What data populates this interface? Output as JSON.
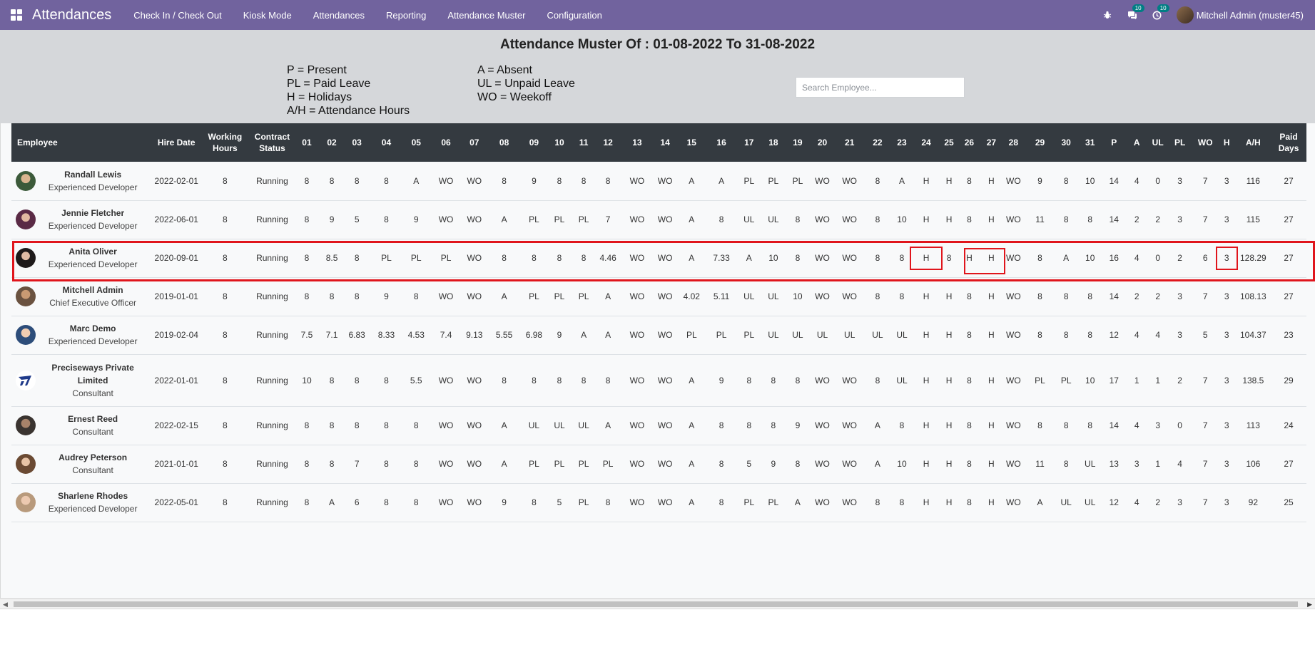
{
  "navbar": {
    "app_title": "Attendances",
    "menu": [
      "Check In / Check Out",
      "Kiosk Mode",
      "Attendances",
      "Reporting",
      "Attendance Muster",
      "Configuration"
    ],
    "messages_badge": "10",
    "activities_badge": "10",
    "user_name": "Mitchell Admin (muster45)",
    "accent_color": "#71639e"
  },
  "header": {
    "title": "Attendance Muster Of : 01-08-2022 To 31-08-2022",
    "legend_left": [
      "P = Present",
      "PL = Paid Leave",
      "H = Holidays",
      "A/H = Attendance Hours"
    ],
    "legend_right": [
      "A = Absent",
      "UL = Unpaid Leave",
      "WO = Weekoff"
    ],
    "search_placeholder": "Search Employee..."
  },
  "table": {
    "columns": [
      "Employee",
      "Hire Date",
      "Working Hours",
      "Contract Status",
      "01",
      "02",
      "03",
      "04",
      "05",
      "06",
      "07",
      "08",
      "09",
      "10",
      "11",
      "12",
      "13",
      "14",
      "15",
      "16",
      "17",
      "18",
      "19",
      "20",
      "21",
      "22",
      "23",
      "24",
      "25",
      "26",
      "27",
      "28",
      "29",
      "30",
      "31",
      "P",
      "A",
      "UL",
      "PL",
      "WO",
      "H",
      "A/H",
      "Paid Days"
    ],
    "rows": [
      {
        "name": "Randall Lewis",
        "job": "Experienced Developer",
        "cells": [
          "2022-02-01",
          "8",
          "Running",
          "8",
          "8",
          "8",
          "8",
          "A",
          "WO",
          "WO",
          "8",
          "9",
          "8",
          "8",
          "8",
          "WO",
          "WO",
          "A",
          "A",
          "PL",
          "PL",
          "PL",
          "WO",
          "WO",
          "8",
          "A",
          "H",
          "H",
          "8",
          "H",
          "WO",
          "9",
          "8",
          "10",
          "14",
          "4",
          "0",
          "3",
          "7",
          "3",
          "116",
          "27"
        ]
      },
      {
        "name": "Jennie Fletcher",
        "job": "Experienced Developer",
        "cells": [
          "2022-06-01",
          "8",
          "Running",
          "8",
          "9",
          "5",
          "8",
          "9",
          "WO",
          "WO",
          "A",
          "PL",
          "PL",
          "PL",
          "7",
          "WO",
          "WO",
          "A",
          "8",
          "UL",
          "UL",
          "8",
          "WO",
          "WO",
          "8",
          "10",
          "H",
          "H",
          "8",
          "H",
          "WO",
          "11",
          "8",
          "8",
          "14",
          "2",
          "2",
          "3",
          "7",
          "3",
          "115",
          "27"
        ]
      },
      {
        "name": "Anita Oliver",
        "job": "Experienced Developer",
        "cells": [
          "2020-09-01",
          "8",
          "Running",
          "8",
          "8.5",
          "8",
          "PL",
          "PL",
          "PL",
          "WO",
          "8",
          "8",
          "8",
          "8",
          "4.46",
          "WO",
          "WO",
          "A",
          "7.33",
          "A",
          "10",
          "8",
          "WO",
          "WO",
          "8",
          "8",
          "H",
          "8",
          "H",
          "H",
          "WO",
          "8",
          "A",
          "10",
          "16",
          "4",
          "0",
          "2",
          "6",
          "3",
          "128.29",
          "27"
        ]
      },
      {
        "name": "Mitchell Admin",
        "job": "Chief Executive Officer",
        "cells": [
          "2019-01-01",
          "8",
          "Running",
          "8",
          "8",
          "8",
          "9",
          "8",
          "WO",
          "WO",
          "A",
          "PL",
          "PL",
          "PL",
          "A",
          "WO",
          "WO",
          "4.02",
          "5.11",
          "UL",
          "UL",
          "10",
          "WO",
          "WO",
          "8",
          "8",
          "H",
          "H",
          "8",
          "H",
          "WO",
          "8",
          "8",
          "8",
          "14",
          "2",
          "2",
          "3",
          "7",
          "3",
          "108.13",
          "27"
        ]
      },
      {
        "name": "Marc Demo",
        "job": "Experienced Developer",
        "cells": [
          "2019-02-04",
          "8",
          "Running",
          "7.5",
          "7.1",
          "6.83",
          "8.33",
          "4.53",
          "7.4",
          "9.13",
          "5.55",
          "6.98",
          "9",
          "A",
          "A",
          "WO",
          "WO",
          "PL",
          "PL",
          "PL",
          "UL",
          "UL",
          "UL",
          "UL",
          "UL",
          "UL",
          "H",
          "H",
          "8",
          "H",
          "WO",
          "8",
          "8",
          "8",
          "12",
          "4",
          "4",
          "3",
          "5",
          "3",
          "104.37",
          "23"
        ]
      },
      {
        "name": "Preciseways Private Limited",
        "job": "Consultant",
        "cells": [
          "2022-01-01",
          "8",
          "Running",
          "10",
          "8",
          "8",
          "8",
          "5.5",
          "WO",
          "WO",
          "8",
          "8",
          "8",
          "8",
          "8",
          "WO",
          "WO",
          "A",
          "9",
          "8",
          "8",
          "8",
          "WO",
          "WO",
          "8",
          "UL",
          "H",
          "H",
          "8",
          "H",
          "WO",
          "PL",
          "PL",
          "10",
          "17",
          "1",
          "1",
          "2",
          "7",
          "3",
          "138.5",
          "29"
        ]
      },
      {
        "name": "Ernest Reed",
        "job": "Consultant",
        "cells": [
          "2022-02-15",
          "8",
          "Running",
          "8",
          "8",
          "8",
          "8",
          "8",
          "WO",
          "WO",
          "A",
          "UL",
          "UL",
          "UL",
          "A",
          "WO",
          "WO",
          "A",
          "8",
          "8",
          "8",
          "9",
          "WO",
          "WO",
          "A",
          "8",
          "H",
          "H",
          "8",
          "H",
          "WO",
          "8",
          "8",
          "8",
          "14",
          "4",
          "3",
          "0",
          "7",
          "3",
          "113",
          "24"
        ]
      },
      {
        "name": "Audrey Peterson",
        "job": "Consultant",
        "cells": [
          "2021-01-01",
          "8",
          "Running",
          "8",
          "8",
          "7",
          "8",
          "8",
          "WO",
          "WO",
          "A",
          "PL",
          "PL",
          "PL",
          "PL",
          "WO",
          "WO",
          "A",
          "8",
          "5",
          "9",
          "8",
          "WO",
          "WO",
          "A",
          "10",
          "H",
          "H",
          "8",
          "H",
          "WO",
          "11",
          "8",
          "UL",
          "13",
          "3",
          "1",
          "4",
          "7",
          "3",
          "106",
          "27"
        ]
      },
      {
        "name": "Sharlene Rhodes",
        "job": "Experienced Developer",
        "cells": [
          "2022-05-01",
          "8",
          "Running",
          "8",
          "A",
          "6",
          "8",
          "8",
          "WO",
          "WO",
          "9",
          "8",
          "5",
          "PL",
          "8",
          "WO",
          "WO",
          "A",
          "8",
          "PL",
          "PL",
          "A",
          "WO",
          "WO",
          "8",
          "8",
          "H",
          "H",
          "8",
          "H",
          "WO",
          "A",
          "UL",
          "UL",
          "12",
          "4",
          "2",
          "3",
          "7",
          "3",
          "92",
          "25"
        ]
      }
    ]
  },
  "highlight_color": "#e0151c"
}
